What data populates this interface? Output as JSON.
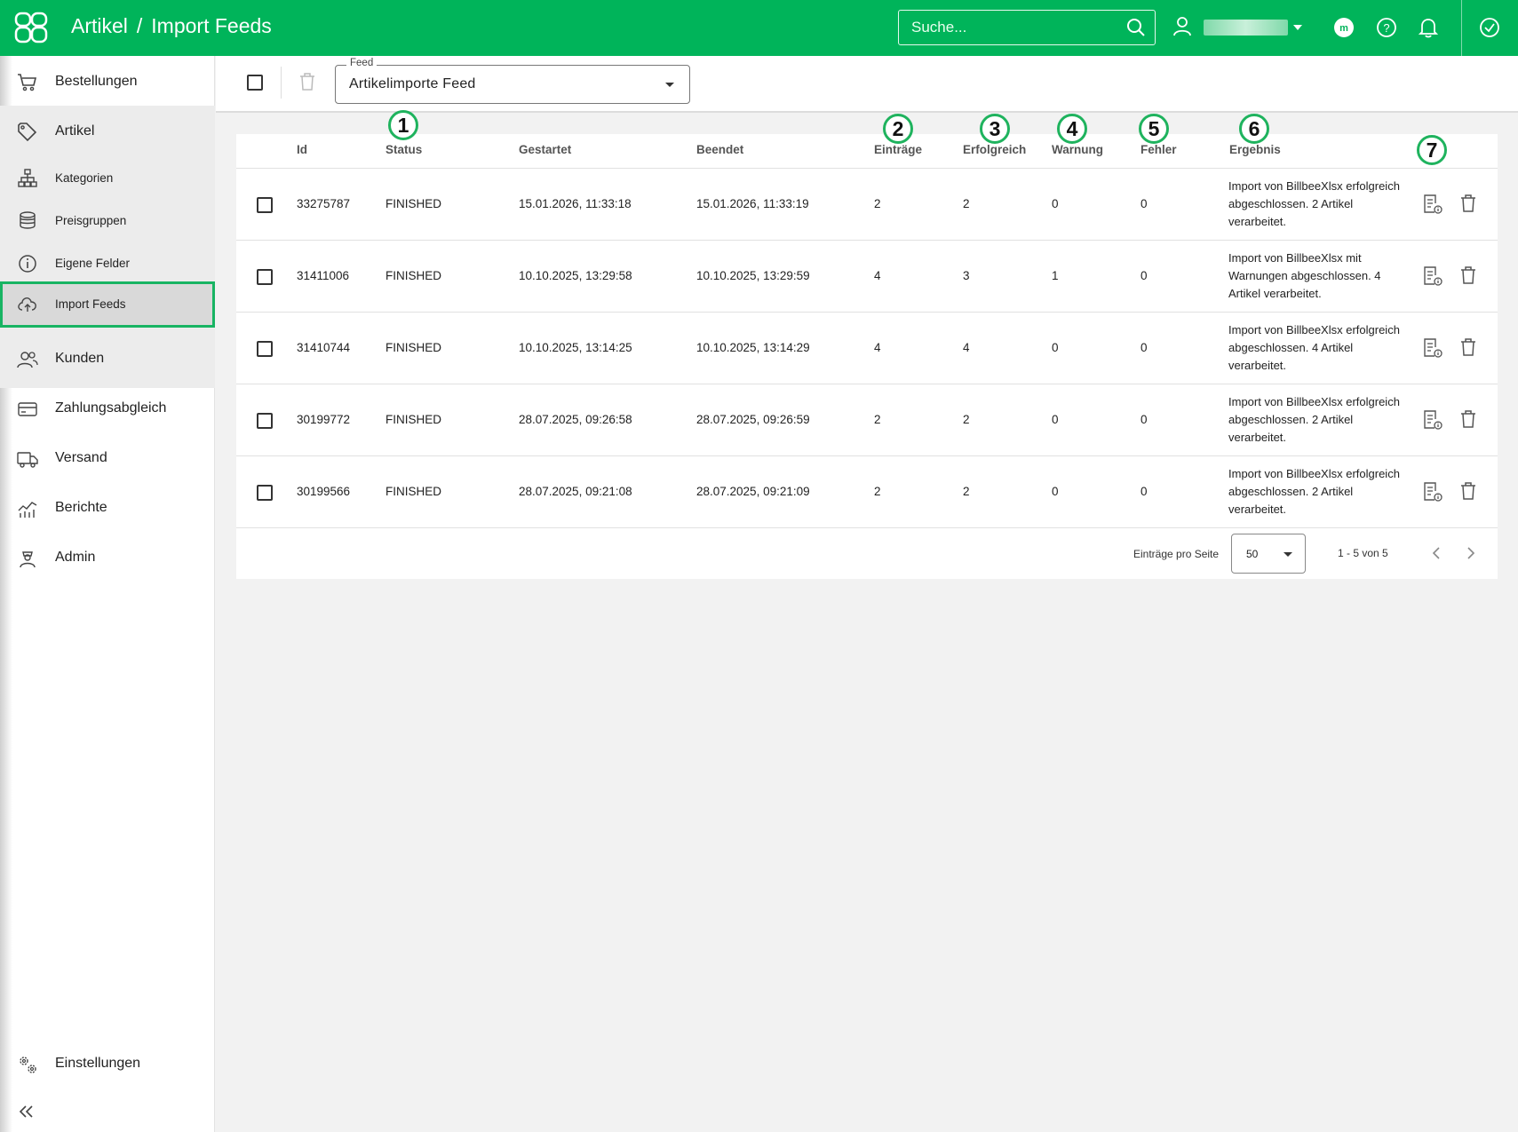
{
  "header": {
    "crumb_parent": "Artikel",
    "crumb_sep": "/",
    "crumb_current": "Import Feeds",
    "search_placeholder": "Suche...",
    "brand_color": "#00b45a"
  },
  "sidebar": {
    "items": [
      {
        "label": "Bestellungen",
        "icon": "cart-icon"
      },
      {
        "label": "Artikel",
        "icon": "tag-icon"
      },
      {
        "label": "Kategorien",
        "icon": "hierarchy-icon"
      },
      {
        "label": "Preisgruppen",
        "icon": "coins-icon"
      },
      {
        "label": "Eigene Felder",
        "icon": "info-icon"
      },
      {
        "label": "Import Feeds",
        "icon": "cloud-upload-icon",
        "active": true
      },
      {
        "label": "Kunden",
        "icon": "users-icon"
      },
      {
        "label": "Zahlungsabgleich",
        "icon": "card-icon"
      },
      {
        "label": "Versand",
        "icon": "truck-icon"
      },
      {
        "label": "Berichte",
        "icon": "chart-icon"
      },
      {
        "label": "Admin",
        "icon": "admin-icon"
      }
    ],
    "settings_label": "Einstellungen"
  },
  "toolbar": {
    "feed_legend": "Feed",
    "feed_value": "Artikelimporte Feed"
  },
  "table": {
    "columns": [
      "Id",
      "Status",
      "Gestartet",
      "Beendet",
      "Einträge",
      "Erfolgreich",
      "Warnung",
      "Fehler",
      "Ergebnis"
    ],
    "rows": [
      {
        "id": "33275787",
        "status": "FINISHED",
        "started": "15.01.2026, 11:33:18",
        "ended": "15.01.2026, 11:33:19",
        "entries": "2",
        "success": "2",
        "warning": "0",
        "error": "0",
        "result": "Import von BillbeeXlsx erfolgreich abgeschlossen. 2 Artikel verarbeitet."
      },
      {
        "id": "31411006",
        "status": "FINISHED",
        "started": "10.10.2025, 13:29:58",
        "ended": "10.10.2025, 13:29:59",
        "entries": "4",
        "success": "3",
        "warning": "1",
        "error": "0",
        "result": "Import von BillbeeXlsx mit Warnungen abgeschlossen. 4 Artikel verarbeitet."
      },
      {
        "id": "31410744",
        "status": "FINISHED",
        "started": "10.10.2025, 13:14:25",
        "ended": "10.10.2025, 13:14:29",
        "entries": "4",
        "success": "4",
        "warning": "0",
        "error": "0",
        "result": "Import von BillbeeXlsx erfolgreich abgeschlossen. 4 Artikel verarbeitet."
      },
      {
        "id": "30199772",
        "status": "FINISHED",
        "started": "28.07.2025, 09:26:58",
        "ended": "28.07.2025, 09:26:59",
        "entries": "2",
        "success": "2",
        "warning": "0",
        "error": "0",
        "result": "Import von BillbeeXlsx erfolgreich abgeschlossen. 2 Artikel verarbeitet."
      },
      {
        "id": "30199566",
        "status": "FINISHED",
        "started": "28.07.2025, 09:21:08",
        "ended": "28.07.2025, 09:21:09",
        "entries": "2",
        "success": "2",
        "warning": "0",
        "error": "0",
        "result": "Import von BillbeeXlsx erfolgreich abgeschlossen. 2 Artikel verarbeitet."
      }
    ]
  },
  "pagination": {
    "per_page_label": "Einträge pro Seite",
    "per_page_value": "50",
    "range": "1 - 5 von 5"
  },
  "badges": [
    "1",
    "2",
    "3",
    "4",
    "5",
    "6",
    "7"
  ],
  "annotation_color": "#1fb35e"
}
